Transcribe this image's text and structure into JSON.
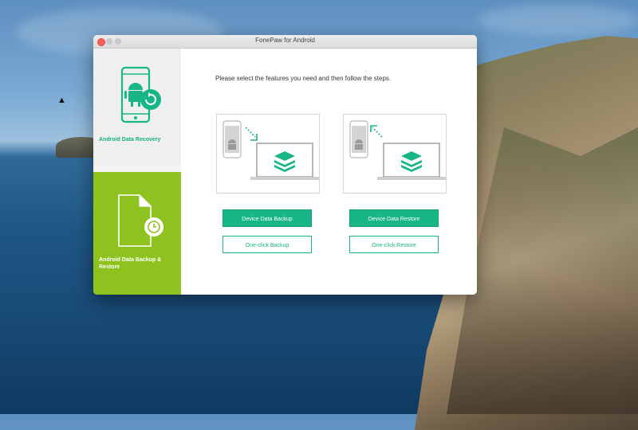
{
  "window": {
    "title": "FonePaw for Android"
  },
  "sidebar": {
    "items": [
      {
        "label": "Android Data Recovery",
        "icon": "android-phone-recovery-icon"
      },
      {
        "label": "Android Data Backup & Restore",
        "icon": "document-restore-icon"
      }
    ]
  },
  "main": {
    "instruction": "Please select the features you need and then follow the steps.",
    "backup": {
      "primary_label": "Device Data Backup",
      "secondary_label": "One-click Backup"
    },
    "restore": {
      "primary_label": "Device Data Restore",
      "secondary_label": "One-click Restore"
    }
  },
  "colors": {
    "accent": "#18b587",
    "sidebar_active": "#8dc21f",
    "close": "#fc5f57"
  }
}
